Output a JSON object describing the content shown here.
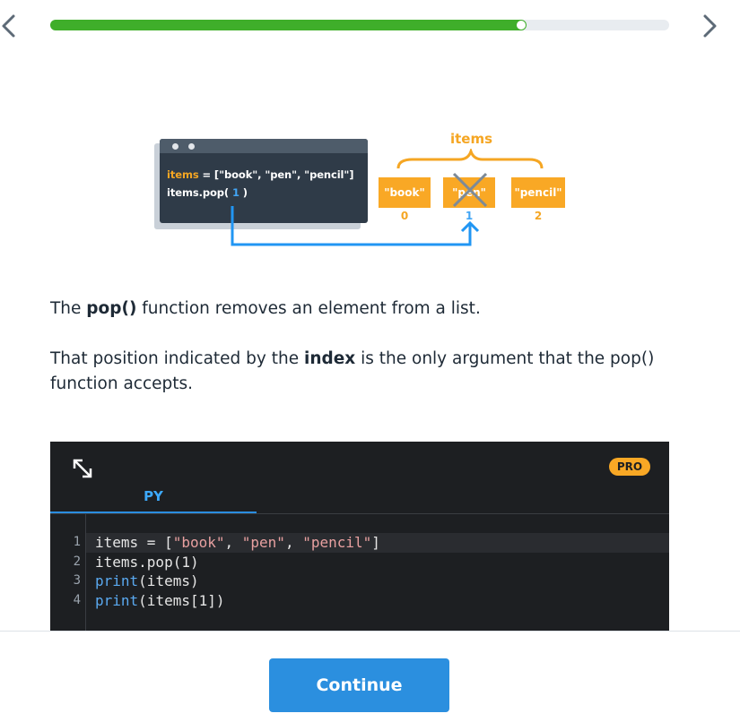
{
  "progress": {
    "fraction": 0.77,
    "fill_color": "#3fae2a"
  },
  "nav": {
    "back_icon": "chevron-left-icon",
    "forward_icon": "chevron-right-icon"
  },
  "illustration": {
    "code_line1_var": "items",
    "code_line1_rest": " = [\"book\", \"pen\", \"pencil\"]",
    "code_line2_pre": "items.pop( ",
    "code_line2_arg": "1",
    "code_line2_post": " )",
    "list_label": "items",
    "elements": [
      {
        "value": "\"book\"",
        "index": "0"
      },
      {
        "value": "\"pen\"",
        "index": "1"
      },
      {
        "value": "\"pencil\"",
        "index": "2"
      }
    ]
  },
  "lesson": {
    "p1_pre": "The ",
    "p1_bold": "pop()",
    "p1_post": " function removes an element from a list.",
    "p2_pre": "That position indicated by the ",
    "p2_bold": "index",
    "p2_post": " is the only argument that the pop() function accepts."
  },
  "editor": {
    "badge": "PRO",
    "tab": "PY",
    "line_numbers": [
      "1",
      "2",
      "3",
      "4"
    ],
    "lines": [
      "items = [\"book\", \"pen\", \"pencil\"]",
      "items.pop(1)",
      "print(items)",
      "print(items[1])"
    ]
  },
  "footer": {
    "continue_label": "Continue"
  }
}
